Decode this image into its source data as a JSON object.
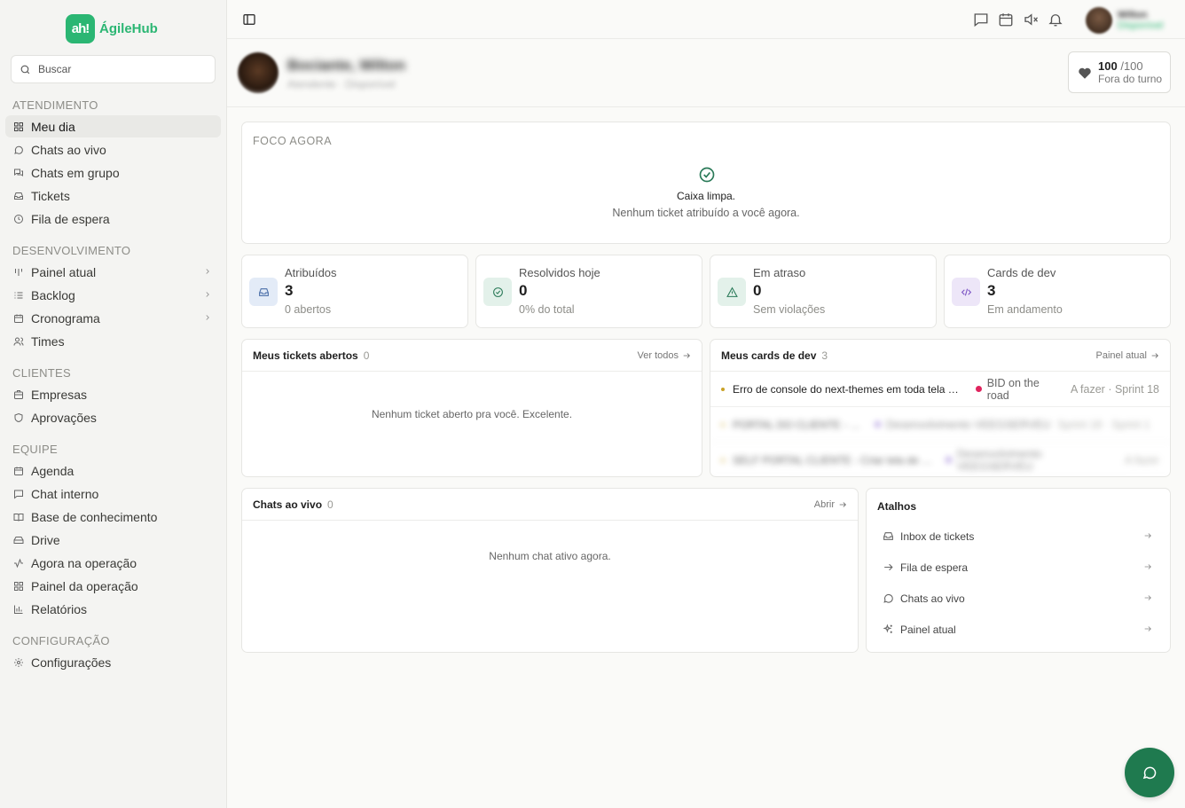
{
  "app": {
    "name": "ÁgileHub",
    "logo_mark": "ah!"
  },
  "colors": {
    "brand": "#2bb673",
    "fab": "#1f7a4f",
    "alert_dot": "#e0245e"
  },
  "search": {
    "placeholder": "Buscar"
  },
  "sidebar": {
    "sections": [
      {
        "title": "ATENDIMENTO",
        "items": [
          {
            "label": "Meu dia",
            "icon": "grid-icon",
            "active": true
          },
          {
            "label": "Chats ao vivo",
            "icon": "chat-bubble-icon"
          },
          {
            "label": "Chats em grupo",
            "icon": "chats-icon"
          },
          {
            "label": "Tickets",
            "icon": "inbox-icon"
          },
          {
            "label": "Fila de espera",
            "icon": "clock-icon"
          }
        ]
      },
      {
        "title": "DESENVOLVIMENTO",
        "items": [
          {
            "label": "Painel atual",
            "icon": "kanban-icon",
            "chevron": true
          },
          {
            "label": "Backlog",
            "icon": "list-icon",
            "chevron": true
          },
          {
            "label": "Cronograma",
            "icon": "calendar-icon",
            "chevron": true
          },
          {
            "label": "Times",
            "icon": "users-icon"
          }
        ]
      },
      {
        "title": "CLIENTES",
        "items": [
          {
            "label": "Empresas",
            "icon": "building-icon"
          },
          {
            "label": "Aprovações",
            "icon": "shield-icon"
          }
        ]
      },
      {
        "title": "EQUIPE",
        "items": [
          {
            "label": "Agenda",
            "icon": "calendar-icon"
          },
          {
            "label": "Chat interno",
            "icon": "message-square-icon"
          },
          {
            "label": "Base de conhecimento",
            "icon": "book-icon"
          },
          {
            "label": "Drive",
            "icon": "drive-icon"
          },
          {
            "label": "Agora na operação",
            "icon": "activity-icon"
          },
          {
            "label": "Painel da operação",
            "icon": "grid-icon"
          },
          {
            "label": "Relatórios",
            "icon": "bar-chart-icon"
          }
        ]
      },
      {
        "title": "CONFIGURAÇÃO",
        "items": [
          {
            "label": "Configurações",
            "icon": "gear-icon"
          }
        ]
      }
    ]
  },
  "header": {
    "user": {
      "name": "Wilton",
      "status": "Disponível"
    },
    "profile": {
      "name": "Bociante, Wilton",
      "subtitle": "Atendente · Disponível"
    },
    "score": {
      "value": "100",
      "max": "/100",
      "label": "Fora do turno"
    }
  },
  "focus": {
    "title": "FOCO AGORA",
    "main": "Caixa limpa.",
    "sub": "Nenhum ticket atribuído a você agora."
  },
  "stats": [
    {
      "label": "Atribuídos",
      "value": "3",
      "sub": "0 abertos",
      "icon": "inbox-icon",
      "color": "#e3ebf7"
    },
    {
      "label": "Resolvidos hoje",
      "value": "0",
      "sub": "0% do total",
      "icon": "check-circle-icon",
      "color": "#e3f1ea"
    },
    {
      "label": "Em atraso",
      "value": "0",
      "sub": "Sem violações",
      "icon": "warning-icon",
      "color": "#e3f1ea"
    },
    {
      "label": "Cards de dev",
      "value": "3",
      "sub": "Em andamento",
      "icon": "code-icon",
      "color": "#ede6f8"
    }
  ],
  "my_tickets": {
    "title": "Meus tickets abertos",
    "count": "0",
    "link": "Ver todos",
    "empty": "Nenhum ticket aberto pra você. Excelente."
  },
  "dev_cards": {
    "title": "Meus cards de dev",
    "count": "3",
    "link": "Painel atual",
    "rows": [
      {
        "title": "Erro de console do next-themes em toda tela — s...",
        "project": "BID on the road",
        "status": "A fazer · Sprint 18"
      },
      {
        "title": "PORTAL DO CLIENTE - ERR...",
        "project": "Desenvolvimento VEEGSERVEU",
        "status": "Sprint 18 · Sprint 1"
      },
      {
        "title": "SELF PORTAL CLIENTE - Criar tela de botão...",
        "project": "Desenvolvimento VEEGSERVEU",
        "status": "A fazer"
      }
    ]
  },
  "live_chats": {
    "title": "Chats ao vivo",
    "count": "0",
    "link": "Abrir",
    "empty": "Nenhum chat ativo agora."
  },
  "shortcuts": {
    "title": "Atalhos",
    "items": [
      {
        "label": "Inbox de tickets",
        "icon": "inbox-icon"
      },
      {
        "label": "Fila de espera",
        "icon": "arrow-right-icon"
      },
      {
        "label": "Chats ao vivo",
        "icon": "chat-bubble-icon"
      },
      {
        "label": "Painel atual",
        "icon": "sparkle-icon"
      }
    ]
  }
}
